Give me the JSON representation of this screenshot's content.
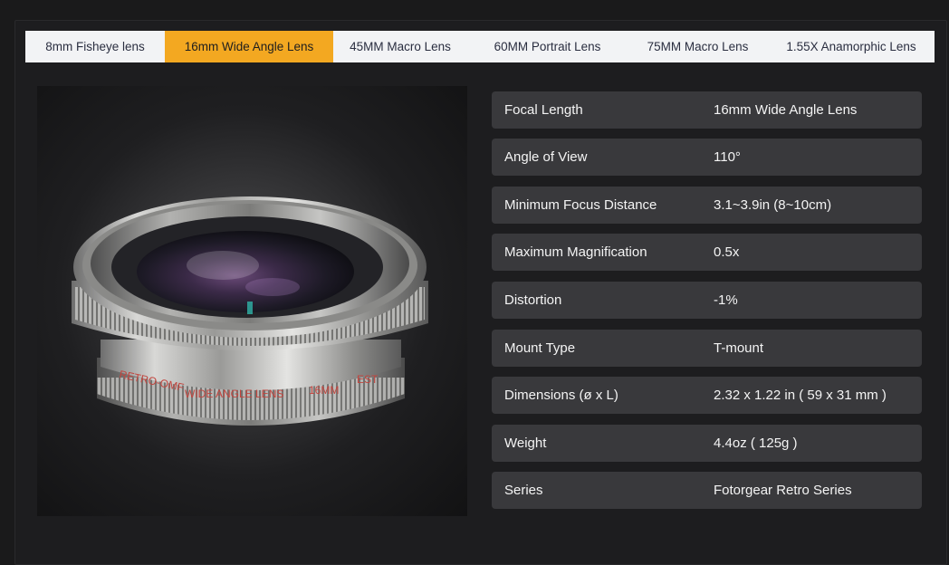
{
  "tabs": [
    {
      "label": "8mm Fisheye lens",
      "active": false
    },
    {
      "label": "16mm Wide Angle Lens",
      "active": true
    },
    {
      "label": "45MM Macro Lens",
      "active": false
    },
    {
      "label": "60MM Portrait Lens",
      "active": false
    },
    {
      "label": "75MM Macro Lens",
      "active": false
    },
    {
      "label": "1.55X Anamorphic Lens",
      "active": false
    }
  ],
  "product_image": {
    "engraving_brand": "RETRO-OMF",
    "engraving_type": "WIDE ANGLE LENS",
    "engraving_focal": "16MM",
    "engraving_est": "EST"
  },
  "specs": [
    {
      "key": "Focal Length",
      "value": "16mm Wide Angle Lens"
    },
    {
      "key": "Angle of View",
      "value": "110°"
    },
    {
      "key": "Minimum Focus Distance",
      "value": "3.1~3.9in (8~10cm)"
    },
    {
      "key": "Maximum Magnification",
      "value": "0.5x"
    },
    {
      "key": "Distortion",
      "value": "-1%"
    },
    {
      "key": "Mount Type",
      "value": "T-mount"
    },
    {
      "key": "Dimensions (ø x L)",
      "value": "2.32 x 1.22 in ( 59 x 31 mm )"
    },
    {
      "key": "Weight",
      "value": "4.4oz ( 125g )"
    },
    {
      "key": "Series",
      "value": "Fotorgear Retro Series"
    }
  ],
  "colors": {
    "accent": "#f3a821",
    "background": "#1a1a1b",
    "row_bg": "#39393c",
    "tab_bar_bg": "#f2f3f5"
  }
}
